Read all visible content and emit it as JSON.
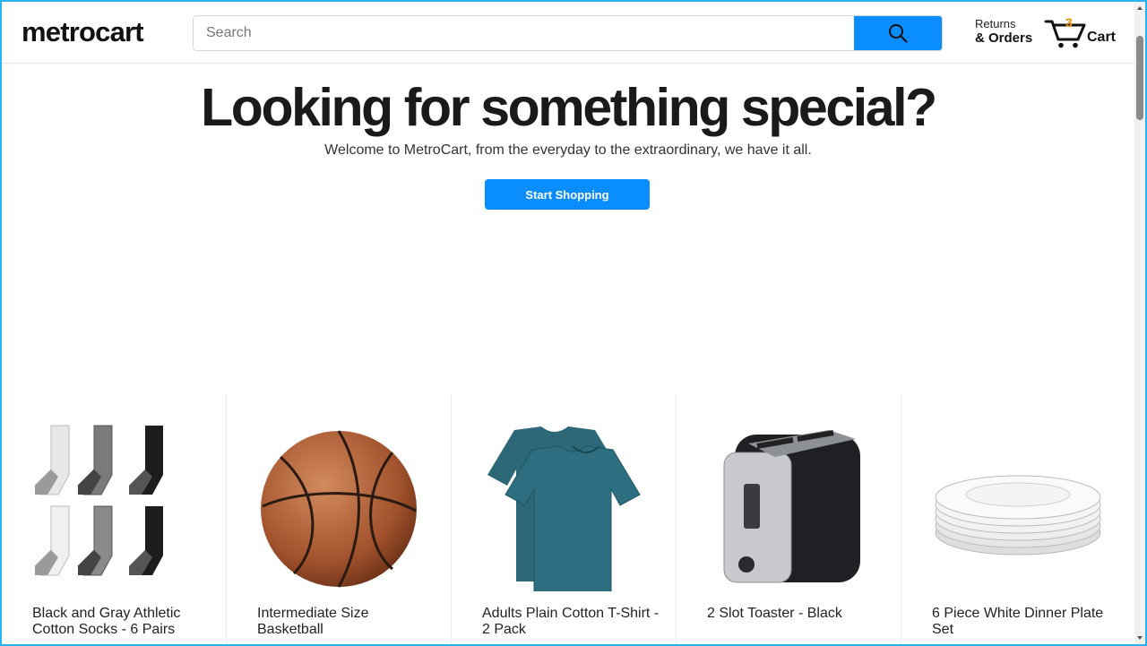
{
  "header": {
    "logo": "metrocart",
    "search_placeholder": "Search",
    "returns_line1": "Returns",
    "returns_line2": "& Orders",
    "cart_count": "3",
    "cart_label": "Cart"
  },
  "hero": {
    "title": "Looking for something special?",
    "subtitle": "Welcome to MetroCart, from the everyday to the extraordinary, we have it all.",
    "cta_label": "Start Shopping"
  },
  "colors": {
    "accent": "#0a8dff",
    "cart_badge": "#f08c00"
  },
  "icons": {
    "search": "search-icon",
    "cart": "cart-icon"
  },
  "products": [
    {
      "name": "Black and Gray Athletic Cotton Socks - 6 Pairs",
      "image": "socks-image"
    },
    {
      "name": "Intermediate Size Basketball",
      "image": "basketball-image"
    },
    {
      "name": "Adults Plain Cotton T-Shirt - 2 Pack",
      "image": "tshirt-image"
    },
    {
      "name": "2 Slot Toaster - Black",
      "image": "toaster-image"
    },
    {
      "name": "6 Piece White Dinner Plate Set",
      "image": "plates-image"
    }
  ]
}
